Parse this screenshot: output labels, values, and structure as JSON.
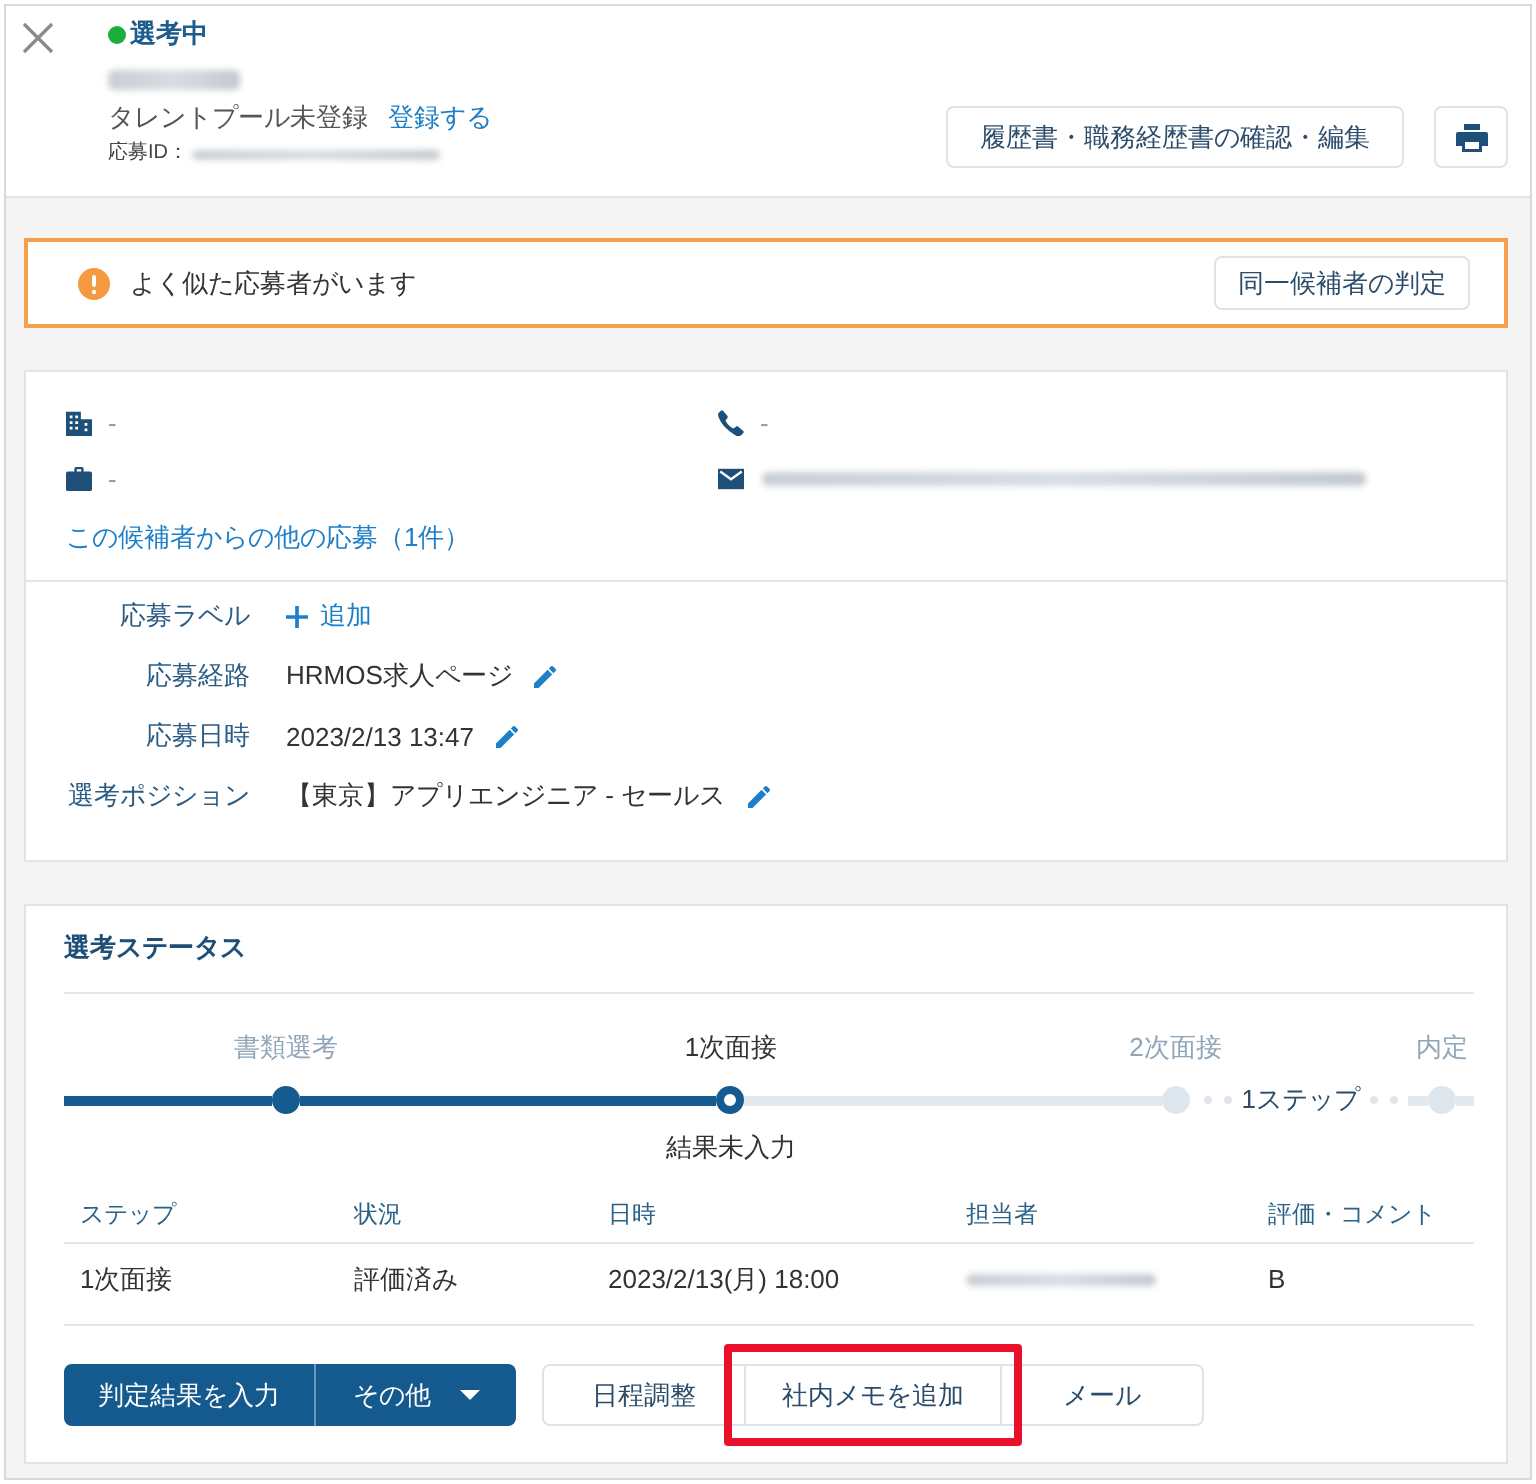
{
  "header": {
    "status": "選考中",
    "name_redacted": true,
    "talent_pool": "タレントプール未登録",
    "register_link": "登録する",
    "application_id_label": "応募ID：",
    "application_id_redacted": true,
    "resume_button": "履歴書・職務経歴書の確認・編集"
  },
  "alert": {
    "message": "よく似た応募者がいます",
    "button": "同一候補者の判定"
  },
  "contact": {
    "company": "-",
    "phone": "-",
    "position": "-",
    "email_redacted": true,
    "other_applications_link": "この候補者からの他の応募（1件）"
  },
  "details": [
    {
      "label": "応募ラベル",
      "kind": "add",
      "value": "追加"
    },
    {
      "label": "応募経路",
      "kind": "editable",
      "value": "HRMOS求人ページ"
    },
    {
      "label": "応募日時",
      "kind": "editable",
      "value": "2023/2/13 13:47"
    },
    {
      "label": "選考ポジション",
      "kind": "editable",
      "value": "【東京】アプリエンジニア - セールス"
    }
  ],
  "selection_status": {
    "title": "選考ステータス",
    "steps": [
      {
        "kind": "step",
        "label": "書類選考",
        "completed": true,
        "current": false
      },
      {
        "kind": "step",
        "label": "1次面接",
        "completed": false,
        "current": true,
        "caption": "結果未入力"
      },
      {
        "kind": "step",
        "label": "2次面接",
        "completed": false,
        "current": false
      },
      {
        "kind": "collapsed",
        "label": "1ステップ"
      },
      {
        "kind": "step",
        "label": "内定",
        "completed": false,
        "current": false
      }
    ],
    "table": {
      "columns": [
        "ステップ",
        "状況",
        "日時",
        "担当者",
        "評価・コメント"
      ],
      "rows": [
        [
          {
            "kind": "text",
            "text": "1次面接"
          },
          {
            "kind": "text",
            "text": "評価済み"
          },
          {
            "kind": "text",
            "text": "2023/2/13(月) 18:00"
          },
          {
            "kind": "redacted"
          },
          {
            "kind": "text",
            "text": "B"
          }
        ]
      ]
    }
  },
  "actions": {
    "primary": "判定結果を入力",
    "more": "その他",
    "buttons": [
      {
        "label": "日程調整",
        "highlighted": false
      },
      {
        "label": "社内メモを追加",
        "highlighted": true
      },
      {
        "label": "メール",
        "highlighted": false
      }
    ]
  }
}
